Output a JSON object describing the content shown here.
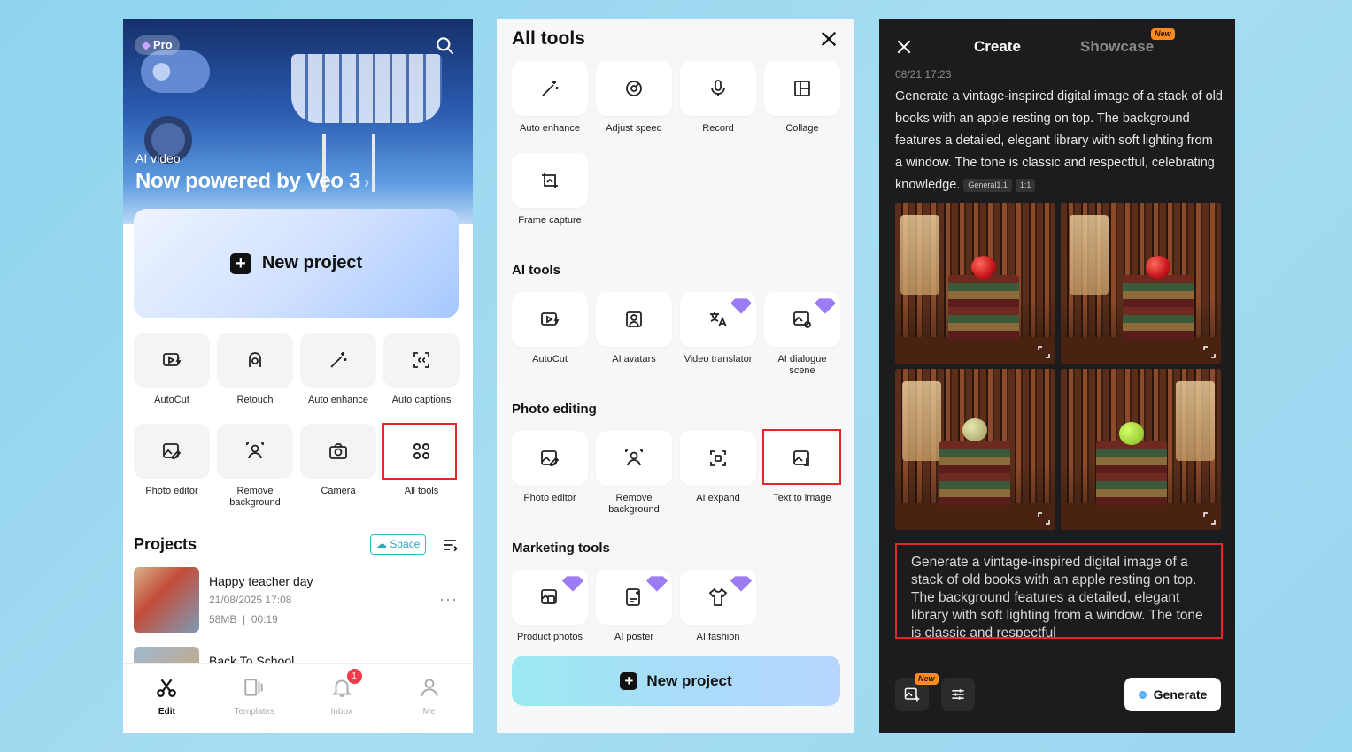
{
  "panel1": {
    "pro_label": "Pro",
    "hero_label": "AI video",
    "hero_title": "Now powered by Veo 3",
    "hero_arrow": "›",
    "new_project_label": "New project",
    "tools": [
      {
        "label": "AutoCut",
        "icon": "autocut-icon"
      },
      {
        "label": "Retouch",
        "icon": "retouch-icon"
      },
      {
        "label": "Auto enhance",
        "icon": "magic-wand-icon"
      },
      {
        "label": "Auto captions",
        "icon": "captions-icon"
      },
      {
        "label": "Photo editor",
        "icon": "photo-edit-icon"
      },
      {
        "label": "Remove background",
        "icon": "person-icon"
      },
      {
        "label": "Camera",
        "icon": "camera-icon"
      },
      {
        "label": "All tools",
        "icon": "grid-icon"
      }
    ],
    "projects_title": "Projects",
    "space_label": "Space",
    "projects": [
      {
        "title": "Happy teacher day",
        "date": "21/08/2025 17:08",
        "size": "58MB",
        "duration": "00:19",
        "more": "···"
      },
      {
        "title": "Back To School"
      }
    ],
    "nav": [
      {
        "label": "Edit",
        "icon": "scissors-icon"
      },
      {
        "label": "Templates",
        "icon": "templates-icon"
      },
      {
        "label": "Inbox",
        "icon": "bell-icon",
        "badge": "1"
      },
      {
        "label": "Me",
        "icon": "user-icon"
      }
    ]
  },
  "panel2": {
    "title": "All tools",
    "top_tools": [
      {
        "label": "Auto enhance"
      },
      {
        "label": "Adjust speed"
      },
      {
        "label": "Record"
      },
      {
        "label": "Collage"
      },
      {
        "label": "Frame capture"
      }
    ],
    "ai_tools_title": "AI tools",
    "ai_tools": [
      {
        "label": "AutoCut"
      },
      {
        "label": "AI avatars"
      },
      {
        "label": "Video translator"
      },
      {
        "label": "AI dialogue scene"
      }
    ],
    "photo_title": "Photo editing",
    "photo_tools": [
      {
        "label": "Photo editor"
      },
      {
        "label": "Remove background"
      },
      {
        "label": "AI expand"
      },
      {
        "label": "Text to image"
      }
    ],
    "marketing_title": "Marketing tools",
    "marketing_tools": [
      {
        "label": "Product photos"
      },
      {
        "label": "AI poster"
      },
      {
        "label": "AI fashion"
      }
    ],
    "cta_label": "New project"
  },
  "panel3": {
    "tab_create": "Create",
    "tab_showcase": "Showcase",
    "new_tag": "New",
    "timestamp": "08/21 17:23",
    "prompt": "Generate a vintage-inspired digital image of a stack of old books with an apple resting on top. The background features a detailed, elegant library with soft lighting from a window. The tone is classic and respectful, celebrating knowledge.",
    "chip_model": "General1.1",
    "chip_ratio": "1:1",
    "input_text": "Generate a vintage-inspired digital image of a stack of old books with an apple resting on top. The background features a detailed, elegant library with soft lighting from a window. The tone is classic and respectful",
    "generate_label": "Generate"
  },
  "colors": {
    "highlight": "#e02828",
    "accent_teal": "#2aa9bd",
    "badge_red": "#f23a4a",
    "new_tag": "#ff8a1e"
  }
}
